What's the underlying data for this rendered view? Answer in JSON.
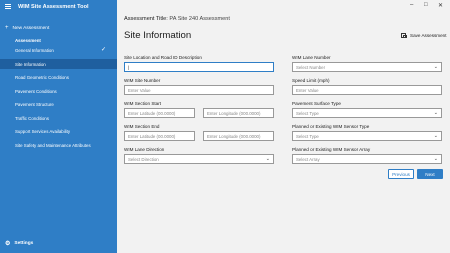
{
  "app": {
    "title": "WIM Site Assessment Tool"
  },
  "sidebar": {
    "new_assessment": "New Assessment",
    "items": [
      {
        "label": "Assessment"
      },
      {
        "label": "General Information"
      },
      {
        "label": "Site Information"
      },
      {
        "label": "Road Geometric Conditions"
      },
      {
        "label": "Pavement Conditions"
      },
      {
        "label": "Pavement Structure"
      },
      {
        "label": "Traffic Conditions"
      },
      {
        "label": "Support Services Availability"
      },
      {
        "label": "Site Safety and Maintenance Attributes"
      }
    ],
    "settings": "Settings"
  },
  "header": {
    "assessment_label": "Assessment Title:",
    "assessment_value": "PA Site 240 Assessment",
    "page_title": "Site Information",
    "save_label": "Save Assessment"
  },
  "form": {
    "location_desc": {
      "label": "Site Location and Road ID Description",
      "value": "|"
    },
    "wim_site_number": {
      "label": "WIM Site Number",
      "placeholder": "Enter Value"
    },
    "section_start": {
      "label": "WIM Section Start",
      "lat_placeholder": "Enter Latitude (00.0000)",
      "lon_placeholder": "Enter Longitude (000.0000)"
    },
    "section_end": {
      "label": "WIM Section End",
      "lat_placeholder": "Enter Latitude (00.0000)",
      "lon_placeholder": "Enter Longitude (000.0000)"
    },
    "lane_direction": {
      "label": "WIM Lane Direction",
      "placeholder": "Select Direction"
    },
    "lane_number": {
      "label": "WIM Lane Number",
      "placeholder": "Select Number"
    },
    "speed_limit": {
      "label": "Speed Limit (mph)",
      "placeholder": "Enter Value"
    },
    "surface_type": {
      "label": "Pavement Surface Type",
      "placeholder": "Select Type"
    },
    "sensor_type": {
      "label": "Planned or Existing WIM Sensor Type",
      "placeholder": "Select Type"
    },
    "sensor_array": {
      "label": "Planned or Existing WIM Sensor Array",
      "placeholder": "Select Array"
    }
  },
  "footer": {
    "previous": "Previous",
    "next": "Next"
  },
  "colors": {
    "accent": "#2f7ec6",
    "active_nav": "#1f5f9f",
    "background": "#f2f2f2"
  }
}
